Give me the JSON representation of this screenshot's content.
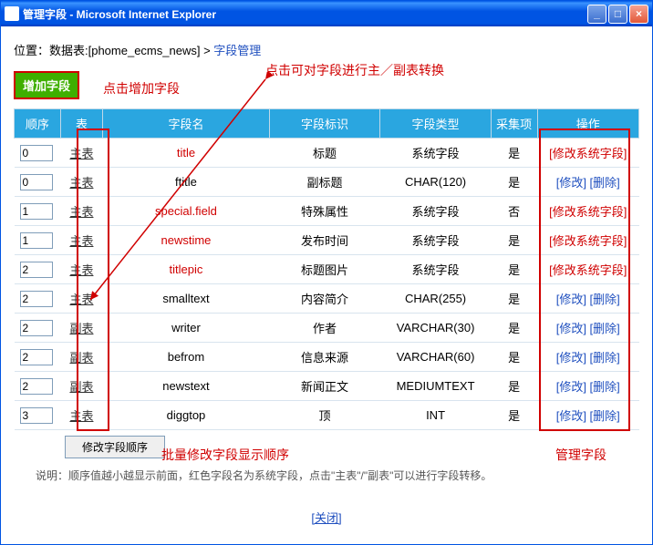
{
  "titlebar": {
    "title": "管理字段 - Microsoft Internet Explorer"
  },
  "breadcrumb": {
    "prefix": "位置：数据表:[phome_ecms_news] > ",
    "current": "字段管理"
  },
  "addbtn": "增加字段",
  "annotations": {
    "convert": "点击可对字段进行主／副表转换",
    "addfield": "点击增加字段",
    "batch": "批量修改字段显示顺序",
    "manage": "管理字段"
  },
  "headers": {
    "order": "顺序",
    "table": "表",
    "fname": "字段名",
    "fident": "字段标识",
    "ftype": "字段类型",
    "collect": "采集项",
    "ops": "操作"
  },
  "rows": [
    {
      "order": "0",
      "table": "主表",
      "fname": "title",
      "fident": "标题",
      "ftype": "系统字段",
      "collect": "是",
      "op": "[修改系统字段]",
      "sys": true
    },
    {
      "order": "0",
      "table": "主表",
      "fname": "ftitle",
      "fident": "副标题",
      "ftype": "CHAR(120)",
      "collect": "是",
      "op": "[修改] [删除]",
      "sys": false
    },
    {
      "order": "1",
      "table": "主表",
      "fname": "special.field",
      "fident": "特殊属性",
      "ftype": "系统字段",
      "collect": "否",
      "op": "[修改系统字段]",
      "sys": true
    },
    {
      "order": "1",
      "table": "主表",
      "fname": "newstime",
      "fident": "发布时间",
      "ftype": "系统字段",
      "collect": "是",
      "op": "[修改系统字段]",
      "sys": true
    },
    {
      "order": "2",
      "table": "主表",
      "fname": "titlepic",
      "fident": "标题图片",
      "ftype": "系统字段",
      "collect": "是",
      "op": "[修改系统字段]",
      "sys": true
    },
    {
      "order": "2",
      "table": "主表",
      "fname": "smalltext",
      "fident": "内容简介",
      "ftype": "CHAR(255)",
      "collect": "是",
      "op": "[修改] [删除]",
      "sys": false
    },
    {
      "order": "2",
      "table": "副表",
      "fname": "writer",
      "fident": "作者",
      "ftype": "VARCHAR(30)",
      "collect": "是",
      "op": "[修改] [删除]",
      "sys": false
    },
    {
      "order": "2",
      "table": "副表",
      "fname": "befrom",
      "fident": "信息来源",
      "ftype": "VARCHAR(60)",
      "collect": "是",
      "op": "[修改] [删除]",
      "sys": false
    },
    {
      "order": "2",
      "table": "副表",
      "fname": "newstext",
      "fident": "新闻正文",
      "ftype": "MEDIUMTEXT",
      "collect": "是",
      "op": "[修改] [删除]",
      "sys": false
    },
    {
      "order": "3",
      "table": "主表",
      "fname": "diggtop",
      "fident": "顶",
      "ftype": "INT",
      "collect": "是",
      "op": "[修改] [删除]",
      "sys": false
    }
  ],
  "batchbtn": "修改字段顺序",
  "note": "说明：顺序值越小越显示前面，红色字段名为系统字段，点击\"主表\"/\"副表\"可以进行字段转移。",
  "closelink": "[关闭]"
}
